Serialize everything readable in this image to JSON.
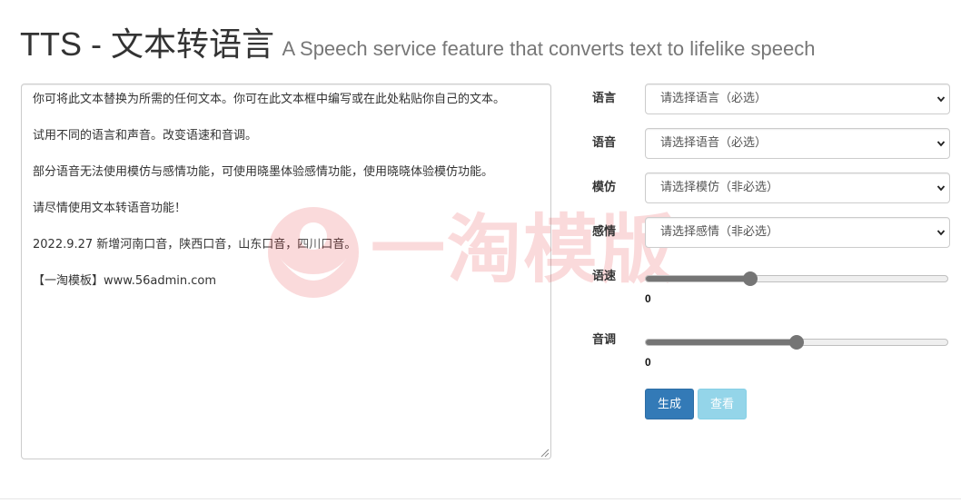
{
  "header": {
    "title": "TTS - 文本转语言",
    "subtitle": "A Speech service feature that converts text to lifelike speech"
  },
  "watermark": {
    "text": "一淘模版",
    "color": "#e4383c"
  },
  "editor": {
    "value": "你可将此文本替换为所需的任何文本。你可在此文本框中编写或在此处粘贴你自己的文本。\n\n试用不同的语言和声音。改变语速和音调。\n\n部分语音无法使用模仿与感情功能，可使用晓墨体验感情功能，使用晓晓体验模仿功能。\n\n请尽情使用文本转语音功能！\n\n2022.9.27 新增河南口音，陕西口音，山东口音，四川口音。\n\n【一淘模板】www.56admin.com"
  },
  "form": {
    "language": {
      "label": "语言",
      "selected": "请选择语言（必选）"
    },
    "voice": {
      "label": "语音",
      "selected": "请选择语音（必选）"
    },
    "style": {
      "label": "模仿",
      "selected": "请选择模仿（非必选）"
    },
    "emotion": {
      "label": "感情",
      "selected": "请选择感情（非必选）"
    },
    "rate": {
      "label": "语速",
      "value": "0",
      "level": 0.34
    },
    "pitch": {
      "label": "音调",
      "value": "0",
      "level": 0.5
    }
  },
  "buttons": {
    "generate": "生成",
    "view": "查看"
  },
  "colors": {
    "primary": "#337ab7",
    "info": "#5bc0de"
  }
}
